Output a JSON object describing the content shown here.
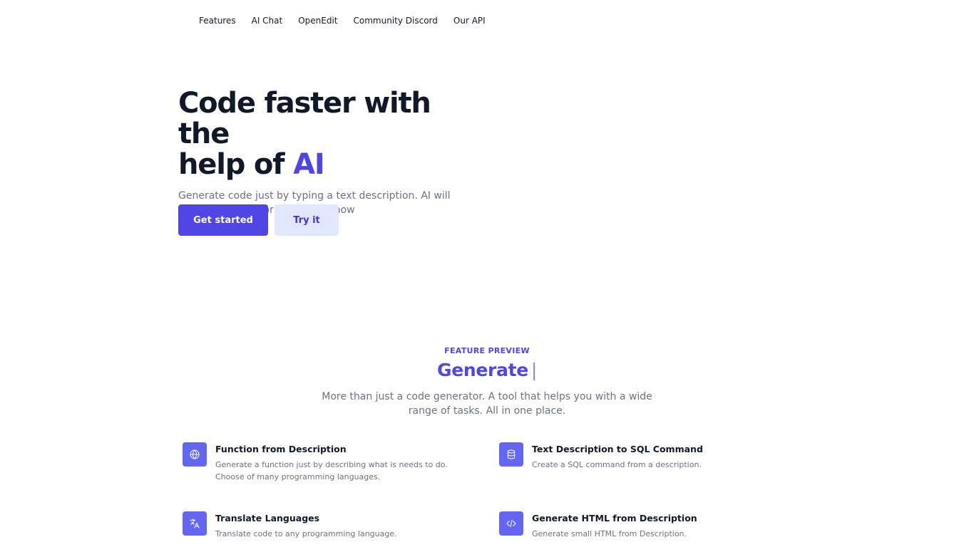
{
  "nav": {
    "items": [
      {
        "label": "Features"
      },
      {
        "label": "AI Chat"
      },
      {
        "label": "OpenEdit"
      },
      {
        "label": "Community Discord"
      },
      {
        "label": "Our API"
      }
    ]
  },
  "hero": {
    "title_line1": "Code faster with the",
    "title_line2_prefix": "help of ",
    "title_accent": "AI",
    "description": "Generate code just by typing a text description. AI will create the code for you. Test it now",
    "primary_button": "Get started",
    "secondary_button": "Try it"
  },
  "features_section": {
    "eyebrow": "FEATURE PREVIEW",
    "title": "Generate",
    "cursor": "|",
    "description": "More than just a code generator. A tool that helps you with a wide range of tasks. All in one place.",
    "items": [
      {
        "icon": "globe-icon",
        "title": "Function from Description",
        "description": "Generate a function just by describing what is needs to do. Choose of many programming languages."
      },
      {
        "icon": "database-icon",
        "title": "Text Description to SQL Command",
        "description": "Create a SQL command from a description."
      },
      {
        "icon": "translate-icon",
        "title": "Translate Languages",
        "description": "Translate code to any programming language."
      },
      {
        "icon": "code-icon",
        "title": "Generate HTML from Description",
        "description": "Generate small HTML from Description."
      }
    ]
  },
  "colors": {
    "accent": "#4f46e5",
    "icon_bg": "#6366f1",
    "secondary_button_bg": "#e0e7ff",
    "text_muted": "#6b7280"
  }
}
